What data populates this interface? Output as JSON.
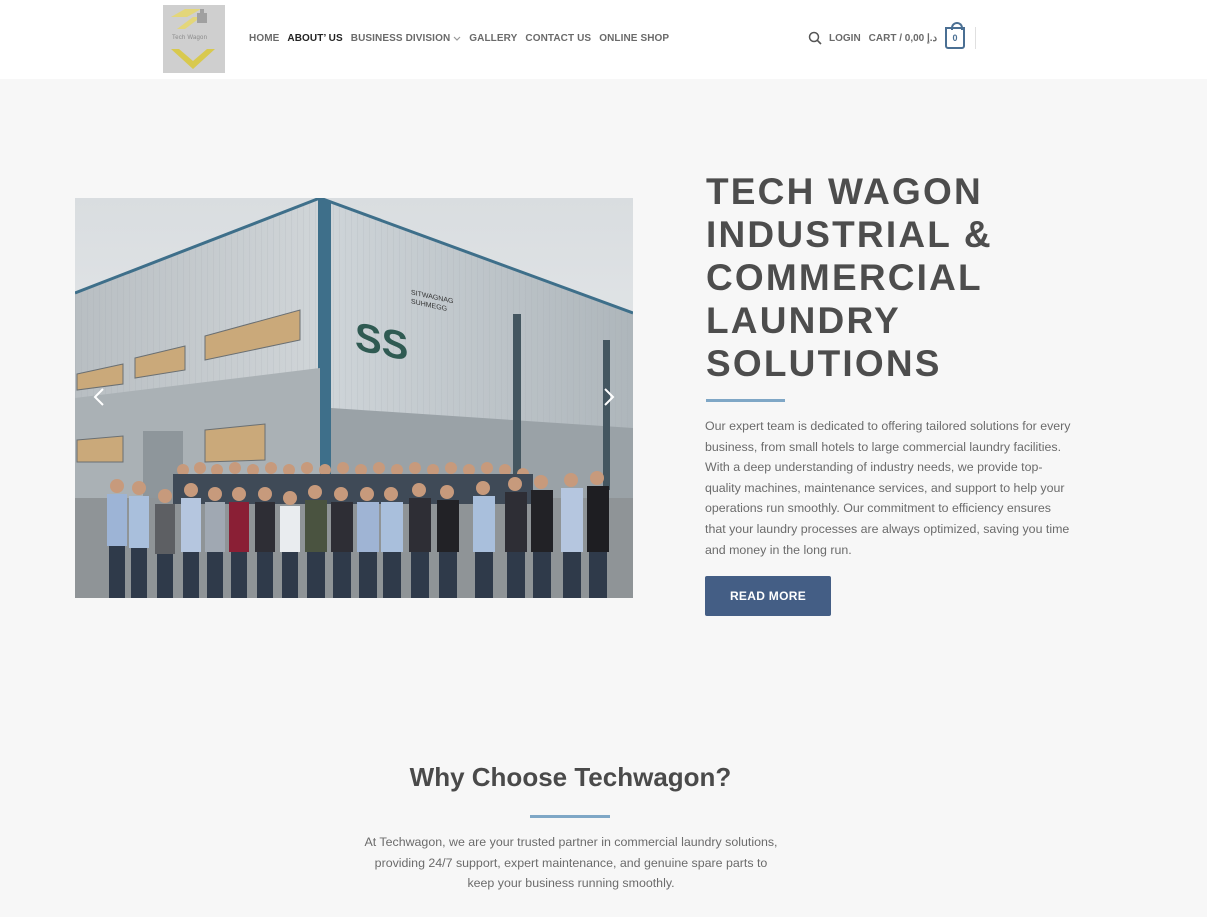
{
  "header": {
    "logo_text": "Tech Wagon",
    "nav": [
      {
        "label": "HOME",
        "active": false
      },
      {
        "label": "ABOUT’ US",
        "active": true
      },
      {
        "label": "BUSINESS DIVISION",
        "active": false,
        "dropdown": true
      },
      {
        "label": "GALLERY",
        "active": false
      },
      {
        "label": "CONTACT US",
        "active": false
      },
      {
        "label": "ONLINE SHOP",
        "active": false
      }
    ],
    "search_icon": "search-icon",
    "login_label": "LOGIN",
    "cart_label": "CART / د.إ 0,00",
    "cart_count": "0"
  },
  "hero": {
    "image_alt": "Team photo in front of industrial building",
    "building_sign": "SS",
    "sign_text_1": "SITWAGNAG",
    "sign_text_2": "SUHMEGG",
    "title": "TECH WAGON INDUSTRIAL & COMMERCIAL LAUNDRY SOLUTIONS",
    "description": "Our expert team is dedicated to offering tailored solutions for every business, from small hotels to large commercial laundry facilities. With a deep understanding of industry needs, we provide top-quality machines, maintenance services, and support to help your operations run smoothly. Our commitment to efficiency ensures that your laundry processes are always optimized, saving you time and money in the long run.",
    "button_label": "READ MORE"
  },
  "why": {
    "title": "Why Choose Techwagon?",
    "text": "At Techwagon, we are your trusted partner in commercial laundry solutions, providing 24/7 support, expert maintenance, and genuine spare parts to keep your business running smoothly."
  },
  "colors": {
    "accent": "#445e85",
    "underline": "#7fa7c6",
    "background": "#f7f7f7"
  }
}
